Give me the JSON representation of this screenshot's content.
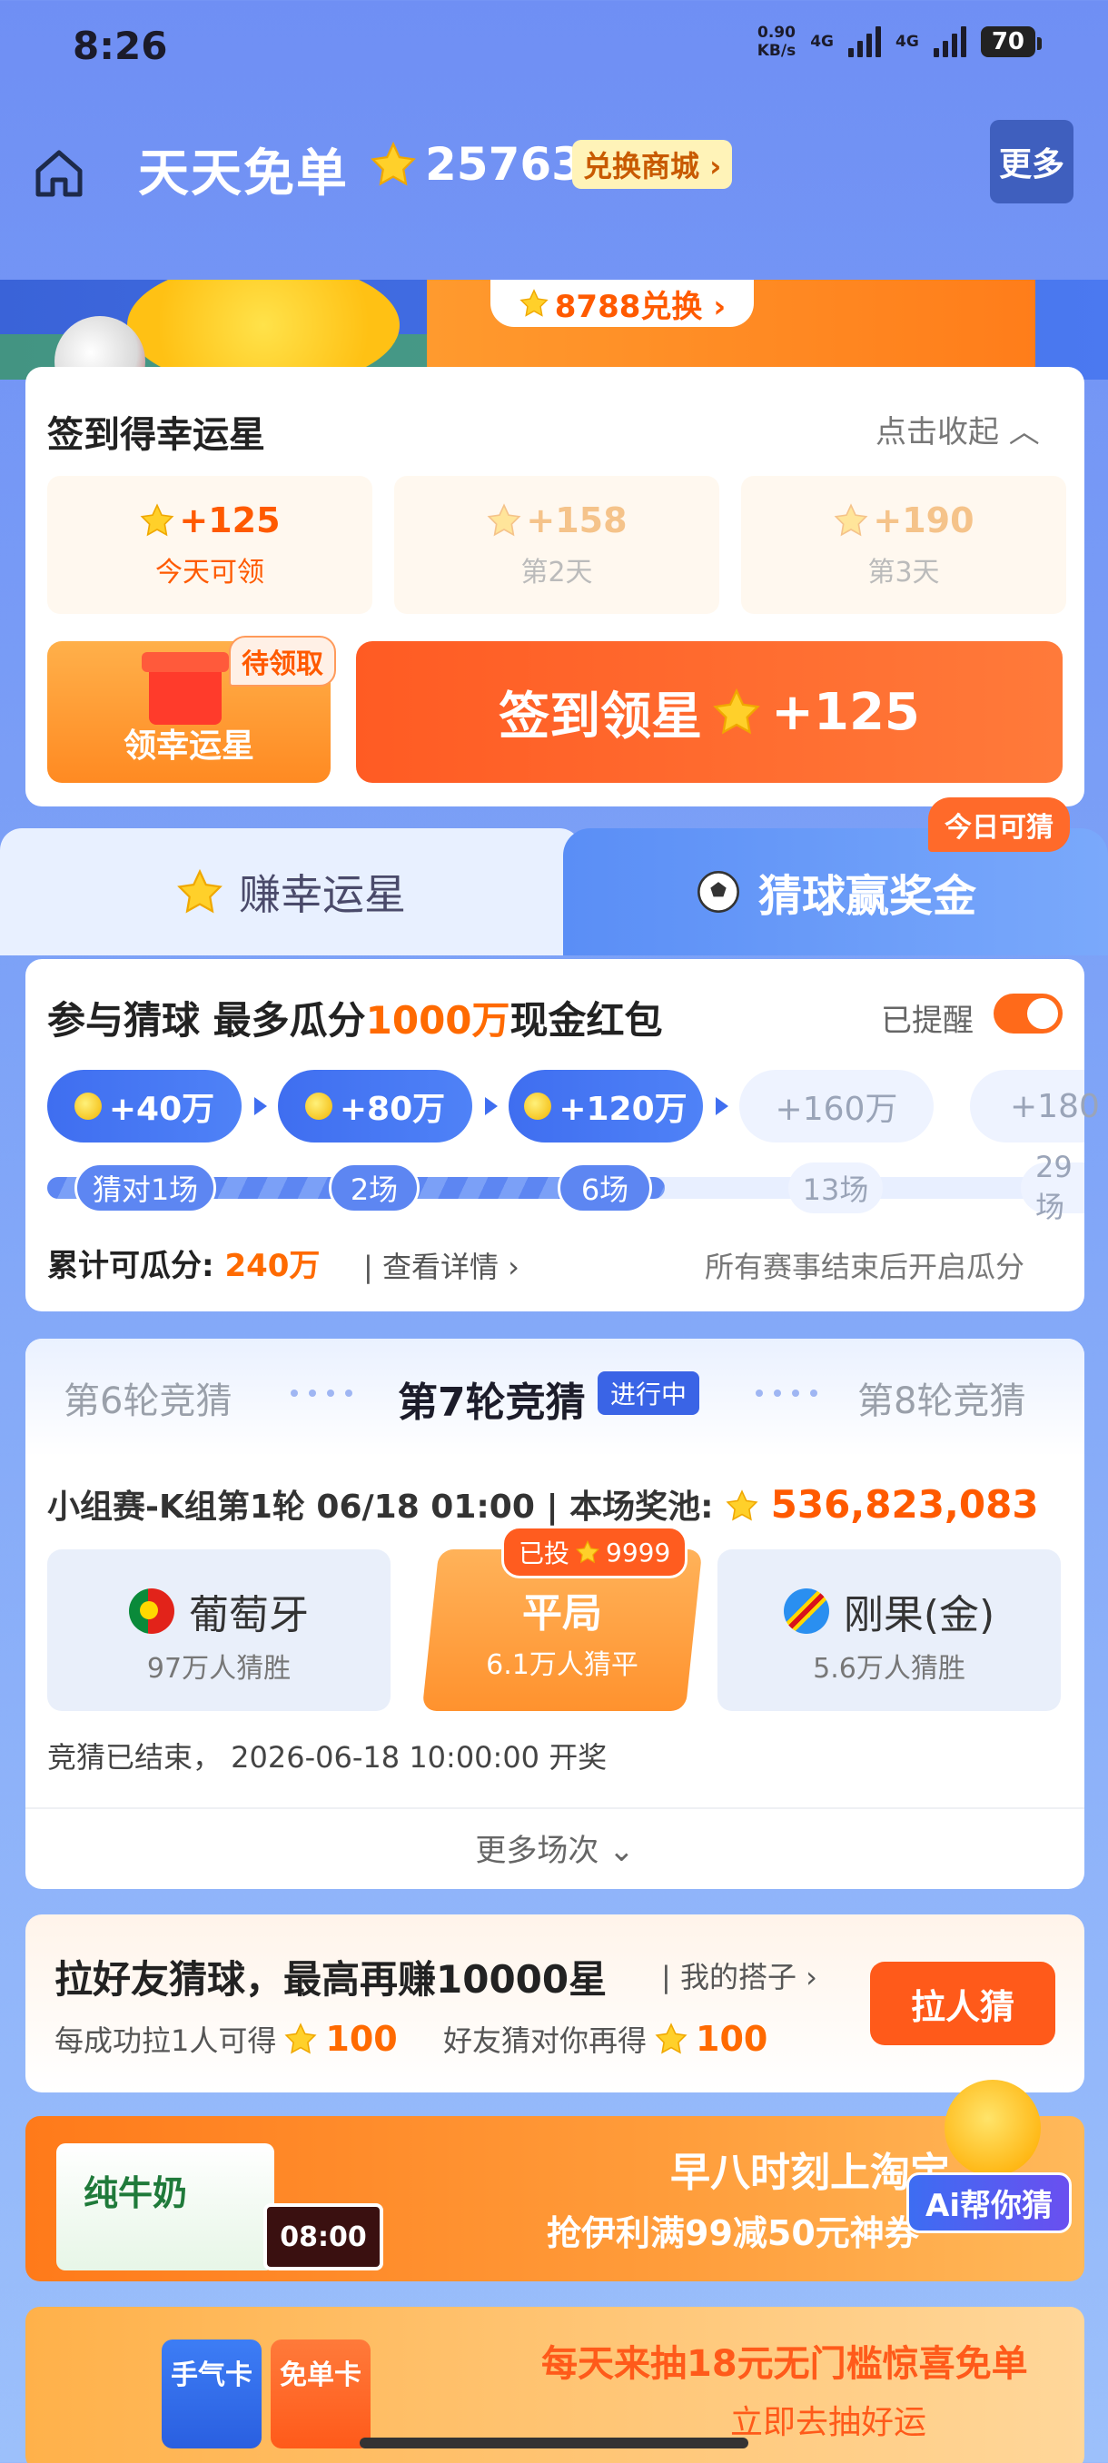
{
  "status_bar": {
    "time": "8:26",
    "net_speed_value": "0.90",
    "net_speed_unit": "KB/s",
    "signal1": "4G",
    "signal2": "4G",
    "battery": "70"
  },
  "header": {
    "title": "天天免单",
    "star_total": "25763",
    "exchange_label": "兑换商城 ›",
    "more_label": "更多"
  },
  "banner": {
    "exchange_pill": "8788兑换 ›"
  },
  "signin": {
    "title": "签到得幸运星",
    "collapse": "点击收起 ︿",
    "days": [
      {
        "points": "+125",
        "label": "今天可领"
      },
      {
        "points": "+158",
        "label": "第2天"
      },
      {
        "points": "+190",
        "label": "第3天"
      }
    ],
    "gift_label": "领幸运星",
    "gift_badge": "待领取",
    "signin_button": "签到领星",
    "signin_points": "+125"
  },
  "tabs": {
    "left": "赚幸运星",
    "right": "猜球赢奖金",
    "today_badge": "今日可猜"
  },
  "guess": {
    "title_pre": "参与猜球 最多瓜分",
    "title_highlight": "1000万",
    "title_post": "现金红包",
    "remind_label": "已提醒",
    "tiers": [
      {
        "amount": "+40万",
        "games": "猜对1场"
      },
      {
        "amount": "+80万",
        "games": "2场"
      },
      {
        "amount": "+120万",
        "games": "6场"
      },
      {
        "amount": "+160万",
        "games": "13场"
      },
      {
        "amount": "+180",
        "games": "29场"
      }
    ],
    "pool_label": "累计可瓜分:",
    "pool_amount": "240万",
    "detail_link": "| 查看详情 ›",
    "pool_note": "所有赛事结束后开启瓜分"
  },
  "rounds": {
    "prev": "第6轮竞猜",
    "current": "第7轮竞猜",
    "current_badge": "进行中",
    "next": "第8轮竞猜",
    "match_info": "小组赛-K组第1轮 06/18 01:00",
    "pool_label": "| 本场奖池:",
    "pool_amount": "536,823,083",
    "home_team": "葡萄牙",
    "home_sub": "97万人猜胜",
    "draw": "平局",
    "draw_sub": "6.1万人猜平",
    "bet_label": "已投",
    "bet_amount": "9999",
    "away_team": "刚果(金)",
    "away_sub": "5.6万人猜胜",
    "end_note": "竞猜已结束， 2026-06-18 10:00:00 开奖",
    "more_games": "更多场次 ⌄"
  },
  "invite": {
    "title": "拉好友猜球，最高再赚10000星",
    "partner_link": "| 我的搭子 ›",
    "sub1_text": "每成功拉1人可得",
    "sub1_amount": "100",
    "sub2_text": "好友猜对你再得",
    "sub2_amount": "100",
    "button": "拉人猜"
  },
  "promo1": {
    "brand": "纯牛奶",
    "clock": "08:00",
    "title": "早八时刻上淘宝",
    "subtitle": "抢伊利满99减50元神券",
    "ai_button": "Ai帮你猜"
  },
  "promo2": {
    "card1": "手气卡",
    "card2": "免单卡",
    "title": "每天来抽18元无门槛惊喜免单",
    "subtitle": "立即去抽好运"
  },
  "colors": {
    "accent_blue": "#3f6ef0",
    "accent_orange": "#ff5a1a"
  }
}
